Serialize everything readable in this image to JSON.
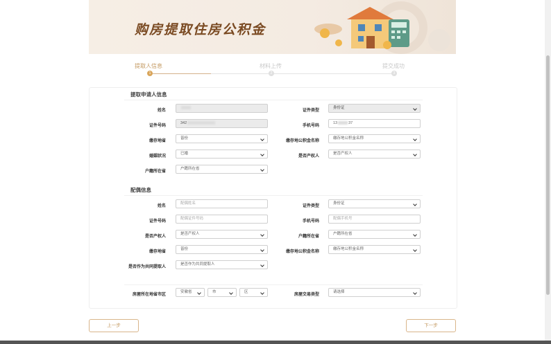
{
  "banner": {
    "title": "购房提取住房公积金"
  },
  "steps": [
    {
      "label": "提取人信息",
      "number": "1",
      "active": true
    },
    {
      "label": "材料上传",
      "number": "2",
      "active": false
    },
    {
      "label": "提交成功",
      "number": "3",
      "active": false
    }
  ],
  "applicant": {
    "section_title": "提取申请人信息",
    "name_label": "姓名",
    "id_type_label": "证件类型",
    "id_type_value": "身份证",
    "id_number_label": "证件号码",
    "id_number_prefix": "342",
    "phone_label": "手机号码",
    "phone_prefix": "13",
    "phone_suffix": "37",
    "deposit_location_label": "缴存地省",
    "deposit_location_value": "皆份",
    "deposit_fund_label": "缴存地公积金名称",
    "deposit_fund_value": "缴存地公积金名称",
    "marital_label": "婚姻状况",
    "marital_value": "已婚",
    "owner_label": "是否产权人",
    "owner_value": "是否产权人",
    "household_label": "户籍所在省",
    "household_value": "户籍所在省"
  },
  "spouse": {
    "section_title": "配偶信息",
    "name_label": "姓名",
    "name_placeholder": "配偶姓名",
    "id_type_label": "证件类型",
    "id_type_value": "身份证",
    "id_number_label": "证件号码",
    "id_number_placeholder": "配偶证件号码",
    "phone_label": "手机号码",
    "phone_placeholder": "配偶手机号",
    "owner_label": "是否产权人",
    "owner_value": "是否产权人",
    "household_label": "户籍所在省",
    "household_value": "户籍所在省",
    "deposit_location_label": "缴存地省",
    "deposit_location_value": "皆份",
    "deposit_fund_label": "缴存地公积金名称",
    "deposit_fund_value": "缴存地公积金名称",
    "joint_label": "是否作为共同提取人",
    "joint_value": "是否作为共同提取人"
  },
  "house": {
    "location_label": "房屋所在地省市区",
    "province_value": "安徽省",
    "city_value": "市",
    "district_value": "区",
    "trade_type_label": "房屋交易类型",
    "trade_type_value": "请选择"
  },
  "buttons": {
    "prev": "上一步",
    "next": "下一步"
  },
  "colors": {
    "accent": "#c49a62",
    "banner_title": "#7a4a22"
  }
}
